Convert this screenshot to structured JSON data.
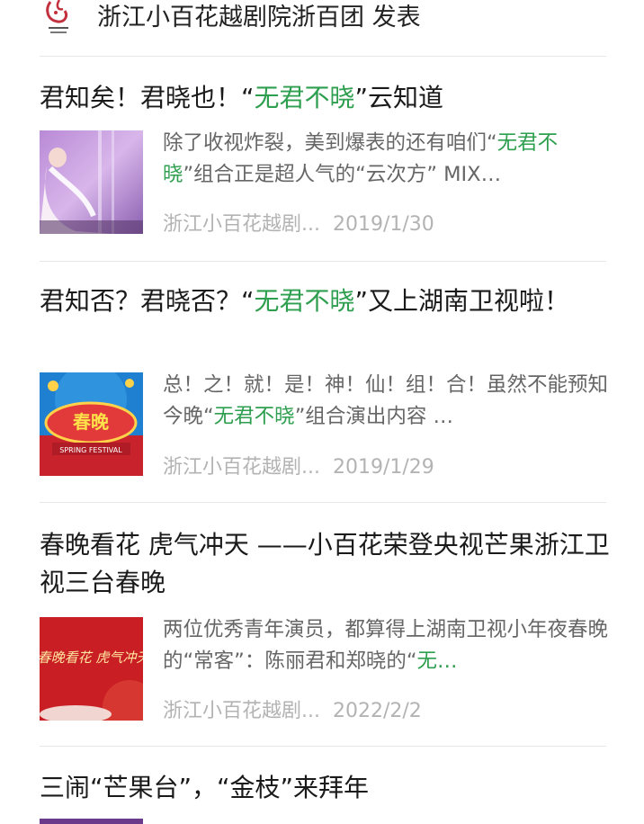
{
  "header": {
    "account_name": "浙江小百花越剧院浙百团",
    "action": "发表"
  },
  "articles": [
    {
      "title_parts": [
        "君知矣！君晓也！“",
        "无君不晓",
        "”云知道"
      ],
      "summary_parts": [
        "除了收视炸裂，美到爆表的还有咱们“",
        "无君不晓",
        "”组合正是超人气的“云次方” MIX…"
      ],
      "source": "浙江小百花越剧...",
      "date": "2019/1/30",
      "thumbnail": "performer-photo"
    },
    {
      "title_parts": [
        "君知否？君晓否？“",
        "无君不晓",
        "”又上湖南卫视啦！"
      ],
      "summary_parts": [
        "总！之！就！是！神！仙！组！合！虽然不能预知今晚“",
        "无君不晓",
        "”组合演出内容 …"
      ],
      "source": "浙江小百花越剧...",
      "date": "2019/1/29",
      "thumbnail": "spring-festival-gala-poster",
      "thumbnail_text": "SPRING FESTIVAL"
    },
    {
      "title_parts": [
        "春晚看花 虎气冲天 ——小百花荣登央视芒果浙江卫视三台春晚",
        "",
        ""
      ],
      "summary_parts": [
        "两位优秀青年演员，都算得上湖南卫视小年夜春晚的“常客”：陈丽君和郑晓的“",
        "无…",
        ""
      ],
      "source": "浙江小百花越剧...",
      "date": "2022/2/2",
      "thumbnail": "calligraphy-poster",
      "thumbnail_text": "春晚看花 虎气冲天"
    },
    {
      "title_parts": [
        "三闹“芒果台”，“金枝”来拜年",
        "",
        ""
      ]
    }
  ]
}
